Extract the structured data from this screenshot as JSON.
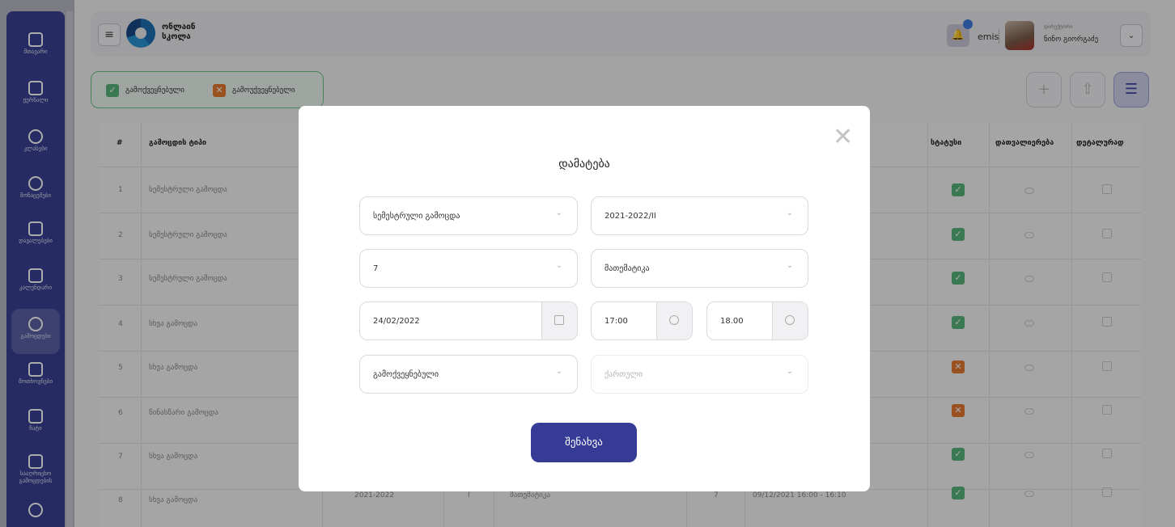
{
  "sidebar": {
    "items": [
      {
        "label": "მთავარი"
      },
      {
        "label": "ჟურნალი"
      },
      {
        "label": "კლასები"
      },
      {
        "label": "მონაცემები"
      },
      {
        "label": "დავალებები"
      },
      {
        "label": "კალენდარი"
      },
      {
        "label": "გამოცდები"
      },
      {
        "label": "მოთხოვნები"
      },
      {
        "label": "ჩატი"
      },
      {
        "label": "სააღრიცხო"
      },
      {
        "label": "გამოცდების"
      }
    ]
  },
  "header": {
    "menu_icon": "≡",
    "brand_line1": "ონლაინ",
    "brand_line2": "სკოლა",
    "bell_icon": "🔔",
    "user_tag": "emis",
    "user_role": "დირექტორი",
    "user_name": "ნინო გიორგაძე",
    "chevron": "⌄"
  },
  "filter": {
    "checked_label": "გამოქვეყნებული",
    "unchecked_label": "გამოუქვეყნებელი",
    "checked_mark": "✓",
    "unchecked_mark": "✕"
  },
  "actions": {
    "add": "+",
    "upload": "⇧",
    "settings": "☰"
  },
  "table": {
    "headers": {
      "num": "#",
      "type": "გამოცდის ტიპი",
      "status": "სტატუსი",
      "details": "დათვალიერება",
      "edit": "დეტალურად"
    },
    "rows": [
      {
        "num": "1",
        "type": "სემესტრული გამოცდა",
        "status": "ok"
      },
      {
        "num": "2",
        "type": "სემესტრული გამოცდა",
        "status": "ok"
      },
      {
        "num": "3",
        "type": "სემესტრული გამოცდა",
        "status": "ok"
      },
      {
        "num": "4",
        "type": "სხვა გამოცდა",
        "status": "ok"
      },
      {
        "num": "5",
        "type": "სხვა გამოცდა",
        "status": "no"
      },
      {
        "num": "6",
        "type": "წინასწარი გამოცდა",
        "status": "no"
      },
      {
        "num": "7",
        "type": "სხვა გამოცდა",
        "status": "ok"
      },
      {
        "num": "8",
        "type": "სხვა გამოცდა",
        "status": "ok",
        "year": "2021-2022",
        "semester": "I",
        "subject": "მათემატიკა",
        "grade": "7",
        "datetime": "09/12/2021 16:00 - 16:10"
      }
    ]
  },
  "modal": {
    "title": "დამატება",
    "close": "✕",
    "exam_type": "სემესტრული გამოცდა",
    "period": "2021-2022/II",
    "grade": "7",
    "subject": "მათემატიკა",
    "date": "24/02/2022",
    "start_time": "17:00",
    "end_time": "18.00",
    "publish_status": "გამოქვეყნებული",
    "language_placeholder": "ქართული",
    "save_label": "შენახვა"
  }
}
